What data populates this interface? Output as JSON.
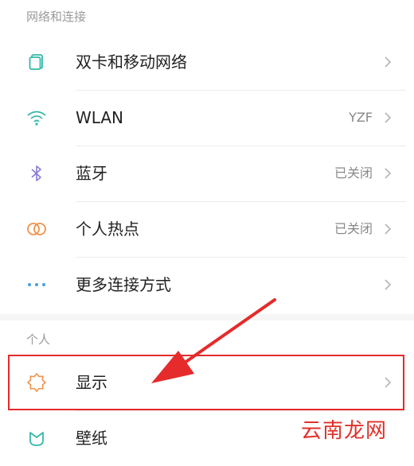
{
  "sections": {
    "network": {
      "title": "网络和连接"
    },
    "personal": {
      "title": "个人"
    }
  },
  "rows": {
    "sim": {
      "label": "双卡和移动网络",
      "icon": "sim-card-icon",
      "color": "#35b7a8"
    },
    "wlan": {
      "label": "WLAN",
      "value": "YZF",
      "icon": "wifi-icon",
      "color": "#35b7a8"
    },
    "bluetooth": {
      "label": "蓝牙",
      "value": "已关闭",
      "icon": "bluetooth-icon",
      "color": "#8c7bd6"
    },
    "hotspot": {
      "label": "个人热点",
      "value": "已关闭",
      "icon": "hotspot-icon",
      "color": "#f0924a"
    },
    "more": {
      "label": "更多连接方式",
      "icon": "more-dots-icon",
      "color": "#4a9fe0"
    },
    "display": {
      "label": "显示",
      "icon": "brightness-icon",
      "color": "#f0924a"
    },
    "wallpaper": {
      "label": "壁纸",
      "icon": "wallpaper-icon",
      "color": "#35b7a8"
    }
  },
  "annotation": {
    "box_color": "#e52b2b",
    "arrow_color": "#e52b2b"
  },
  "watermark": {
    "text": "云南龙网"
  }
}
